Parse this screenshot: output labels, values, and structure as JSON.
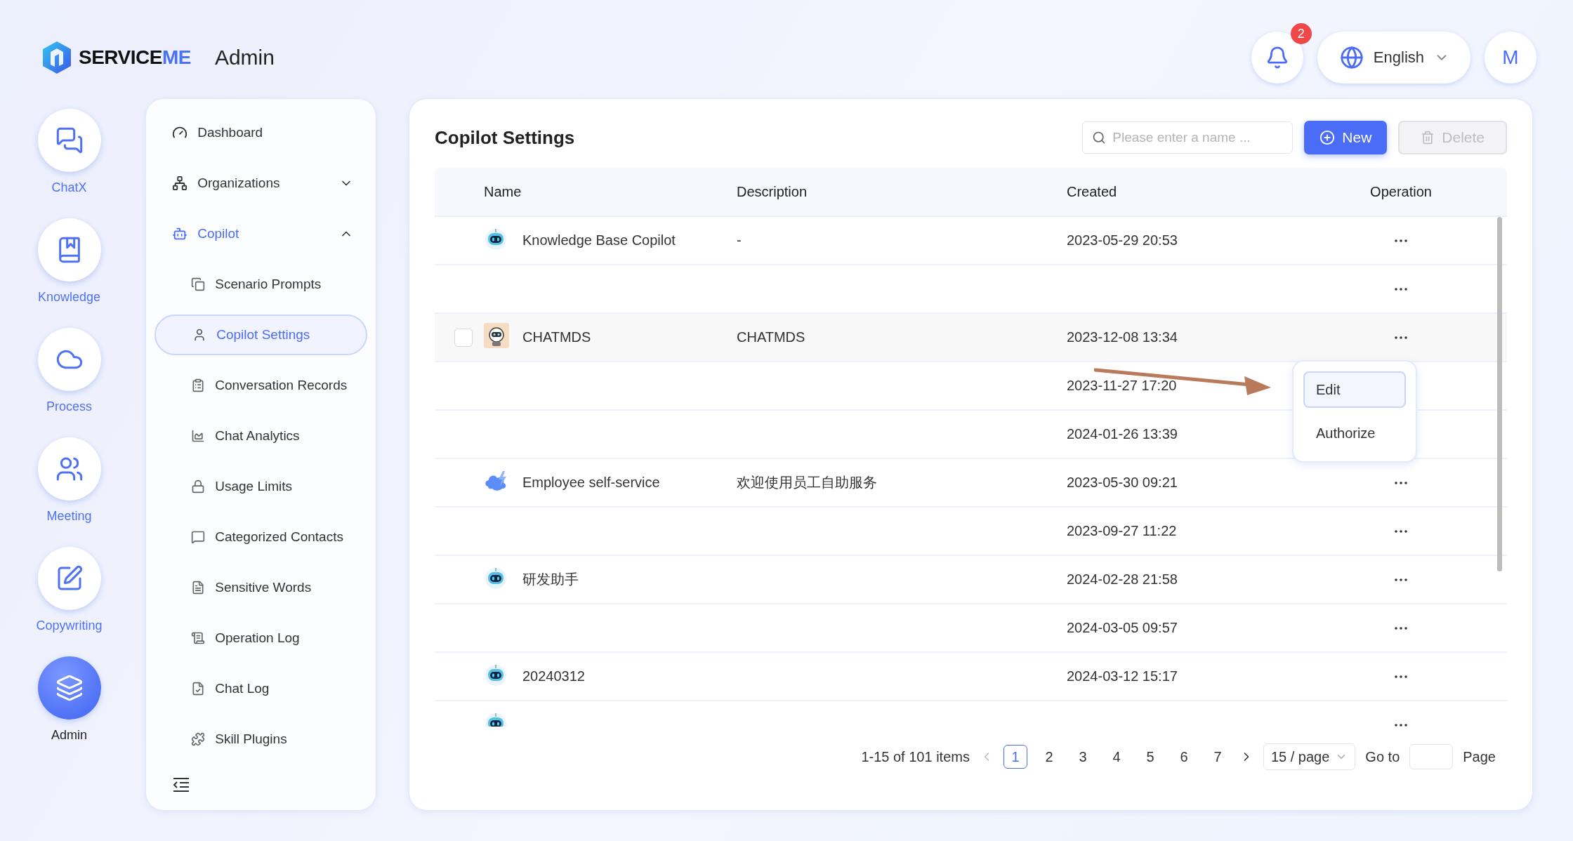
{
  "header": {
    "logo": {
      "dark": "SERVICE",
      "accent": "ME"
    },
    "app_title": "Admin",
    "notifications": {
      "count": "2"
    },
    "language": "English",
    "avatar": "M"
  },
  "rail": [
    {
      "label": "ChatX",
      "selected": false
    },
    {
      "label": "Knowledge",
      "selected": false
    },
    {
      "label": "Process",
      "selected": false
    },
    {
      "label": "Meeting",
      "selected": false
    },
    {
      "label": "Copywriting",
      "selected": false
    },
    {
      "label": "Admin",
      "selected": true
    }
  ],
  "sidebar": {
    "items": [
      {
        "label": "Dashboard",
        "active": false
      },
      {
        "label": "Organizations",
        "active": false,
        "expanded": false
      },
      {
        "label": "Copilot",
        "active": true,
        "expanded": true,
        "children": [
          {
            "label": "Scenario Prompts",
            "selected": false
          },
          {
            "label": "Copilot Settings",
            "selected": true
          },
          {
            "label": "Conversation Records",
            "selected": false
          },
          {
            "label": "Chat Analytics",
            "selected": false
          },
          {
            "label": "Usage Limits",
            "selected": false
          },
          {
            "label": "Categorized Contacts",
            "selected": false
          },
          {
            "label": "Sensitive Words",
            "selected": false
          },
          {
            "label": "Operation Log",
            "selected": false
          },
          {
            "label": "Chat Log",
            "selected": false
          },
          {
            "label": "Skill Plugins",
            "selected": false
          }
        ]
      }
    ]
  },
  "content": {
    "title": "Copilot Settings",
    "search": {
      "placeholder": "Please enter a name ..."
    },
    "buttons": [
      {
        "label": "New",
        "kind": "primary"
      },
      {
        "label": "Delete",
        "kind": "disabled"
      }
    ],
    "table": {
      "columns": [
        "Name",
        "Description",
        "Created",
        "Operation"
      ],
      "rows": [
        {
          "kind": "robot",
          "name": "Knowledge Base Copilot",
          "description": "-",
          "created": "2023-05-29 20:53",
          "hovered": false
        },
        {
          "kind": "plain",
          "hovered": false
        },
        {
          "kind": "photo",
          "name": "CHATMDS",
          "description": "CHATMDS",
          "created": "2023-12-08 13:34",
          "hovered": true
        },
        {
          "kind": "plain",
          "created": "2023-11-27 17:20",
          "hovered": false
        },
        {
          "kind": "plain",
          "created": "2024-01-26 13:39",
          "hovered": false
        },
        {
          "kind": "cloud",
          "name": "Employee self-service",
          "description": "欢迎使用员工自助服务",
          "created": "2023-05-30 09:21",
          "hovered": false
        },
        {
          "kind": "plain",
          "created": "2023-09-27 11:22",
          "hovered": false
        },
        {
          "kind": "robot",
          "name": "研发助手",
          "created": "2024-02-28 21:58",
          "hovered": false
        },
        {
          "kind": "plain",
          "created": "2024-03-05 09:57",
          "hovered": false
        },
        {
          "kind": "robot",
          "name": "20240312",
          "created": "2024-03-12 15:17",
          "hovered": false
        },
        {
          "kind": "robot",
          "hovered": false
        }
      ]
    },
    "menu": {
      "items": [
        {
          "label": "Edit",
          "selected": true
        },
        {
          "label": "Authorize",
          "selected": false
        }
      ]
    },
    "pagination": {
      "summary": "1-15 of 101 items",
      "pages": [
        {
          "label": "1",
          "selected": true
        },
        {
          "label": "2",
          "selected": false
        },
        {
          "label": "3",
          "selected": false
        },
        {
          "label": "4",
          "selected": false
        },
        {
          "label": "5",
          "selected": false
        },
        {
          "label": "6",
          "selected": false
        },
        {
          "label": "7",
          "selected": false
        }
      ],
      "page_size": "15 / page",
      "goto_label": "Go to",
      "page_label": "Page"
    }
  }
}
